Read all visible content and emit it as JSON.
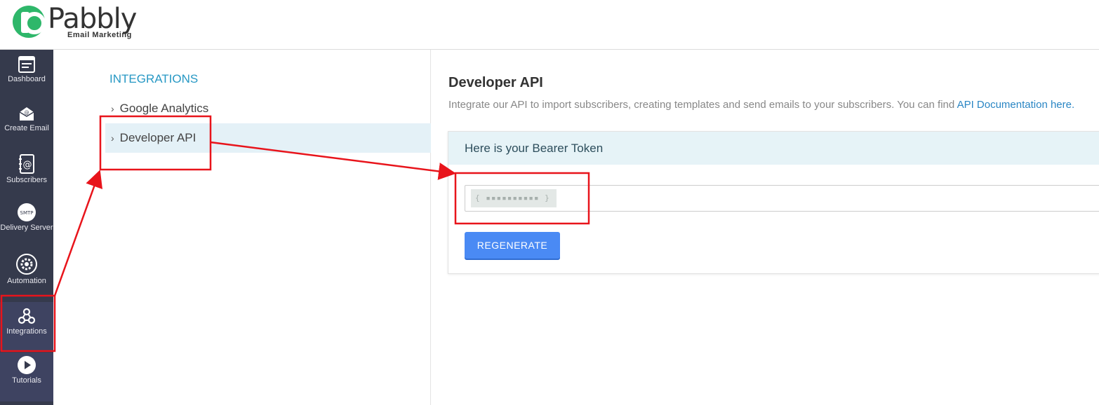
{
  "brand": {
    "name": "Pabbly",
    "subtitle": "Email Marketing",
    "color": "#2eb76a"
  },
  "sidebar": {
    "items": [
      {
        "label": "Dashboard",
        "icon": "dashboard-icon"
      },
      {
        "label": "Create Email",
        "icon": "envelope-icon"
      },
      {
        "label": "Subscribers",
        "icon": "address-book-icon"
      },
      {
        "label": "Delivery Server",
        "icon": "smtp-icon",
        "icon_text": "SMTP"
      },
      {
        "label": "Automation",
        "icon": "gear-icon"
      },
      {
        "label": "Integrations",
        "icon": "webhook-icon"
      },
      {
        "label": "Tutorials",
        "icon": "play-icon"
      }
    ]
  },
  "subnav": {
    "title": "INTEGRATIONS",
    "items": [
      {
        "label": "Google Analytics"
      },
      {
        "label": "Developer API"
      }
    ]
  },
  "main": {
    "title": "Developer API",
    "description": "Integrate our API to import subscribers, creating templates and send emails to your subscribers. You can find ",
    "doc_link": "API Documentation here.",
    "card_title": "Here is your Bearer Token",
    "token_masked": "{ ▪▪▪▪▪▪▪▪▪▪ }",
    "regenerate_label": "REGENERATE"
  },
  "colors": {
    "sidebar_bg": "#353a4c",
    "accent": "#2798c4",
    "button": "#4a8af4",
    "annotation": "#e8141b"
  }
}
